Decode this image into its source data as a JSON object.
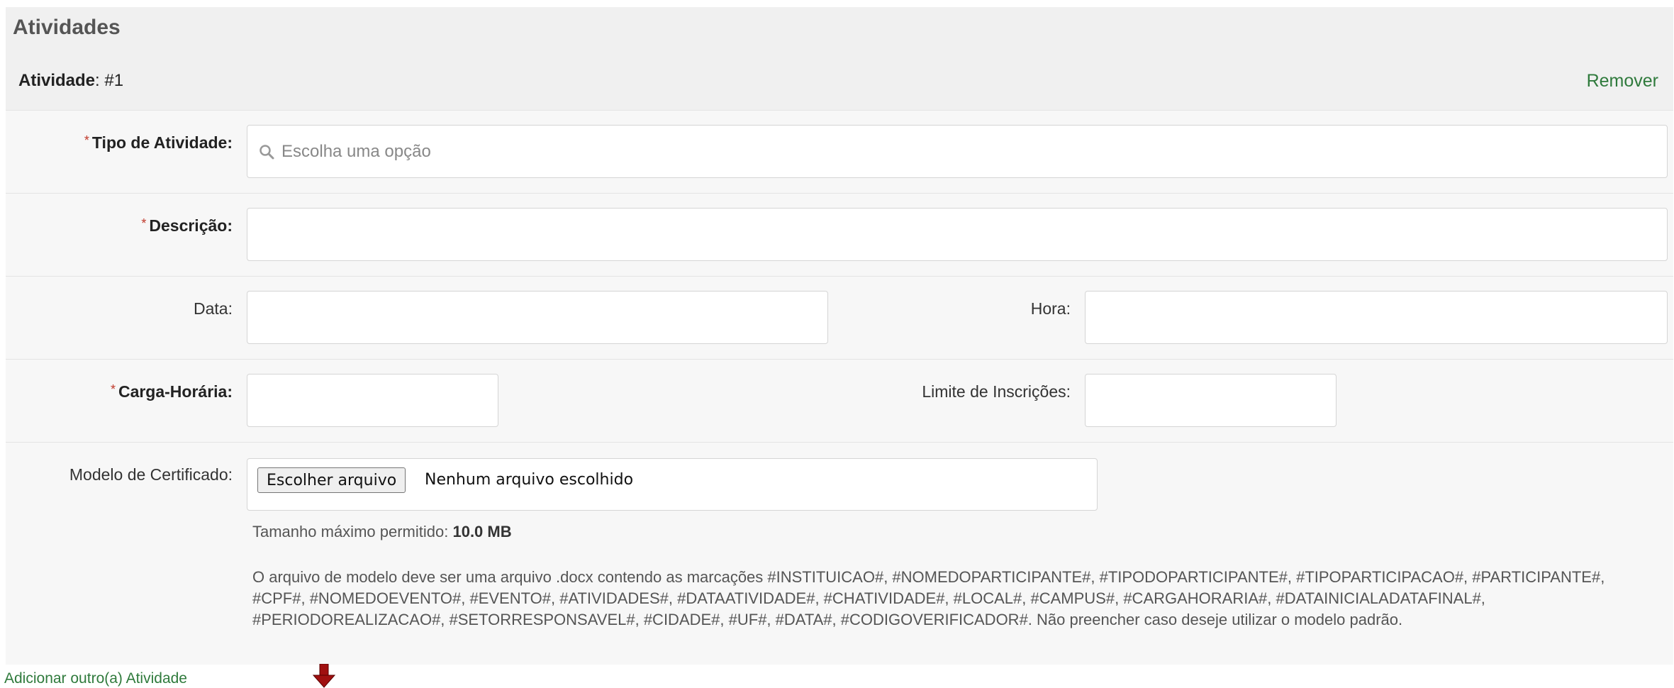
{
  "panel": {
    "title": "Atividades",
    "activity_label": "Atividade",
    "activity_number": ": #1",
    "remove_label": "Remover"
  },
  "form": {
    "tipo": {
      "label": "Tipo de Atividade:",
      "placeholder": "Escolha uma opção",
      "required": true,
      "icon": "search-icon"
    },
    "descricao": {
      "label": "Descrição:",
      "value": "",
      "required": true
    },
    "data": {
      "label": "Data:",
      "value": ""
    },
    "hora": {
      "label": "Hora:",
      "value": ""
    },
    "carga": {
      "label": "Carga-Horária:",
      "value": "",
      "required": true
    },
    "limite": {
      "label": "Limite de Inscrições:",
      "value": ""
    },
    "modelo": {
      "label": "Modelo de Certificado:",
      "button_label": "Escolher arquivo",
      "status": "Nenhum arquivo escolhido",
      "max_size_label": "Tamanho máximo permitido:",
      "max_size_value": "10.0 MB",
      "help_text": "O arquivo de modelo deve ser uma arquivo .docx contendo as marcações #INSTITUICAO#, #NOMEDOPARTICIPANTE#, #TIPODOPARTICIPANTE#, #TIPOPARTICIPACAO#, #PARTICIPANTE#, #CPF#, #NOMEDOEVENTO#, #EVENTO#, #ATIVIDADES#, #DATAATIVIDADE#, #CHATIVIDADE#, #LOCAL#, #CAMPUS#, #CARGAHORARIA#, #DATAINICIALADATAFINAL#, #PERIODOREALIZACAO#, #SETORRESPONSAVEL#, #CIDADE#, #UF#, #DATA#, #CODIGOVERIFICADOR#. Não preencher caso deseje utilizar o modelo padrão."
    }
  },
  "footer": {
    "add_label": "Adicionar outro(a) Atividade",
    "arrow_icon": "down-arrow-icon",
    "arrow_color": "#a01010"
  },
  "colors": {
    "link": "#2f7a3c",
    "required_star": "#c0392b"
  }
}
